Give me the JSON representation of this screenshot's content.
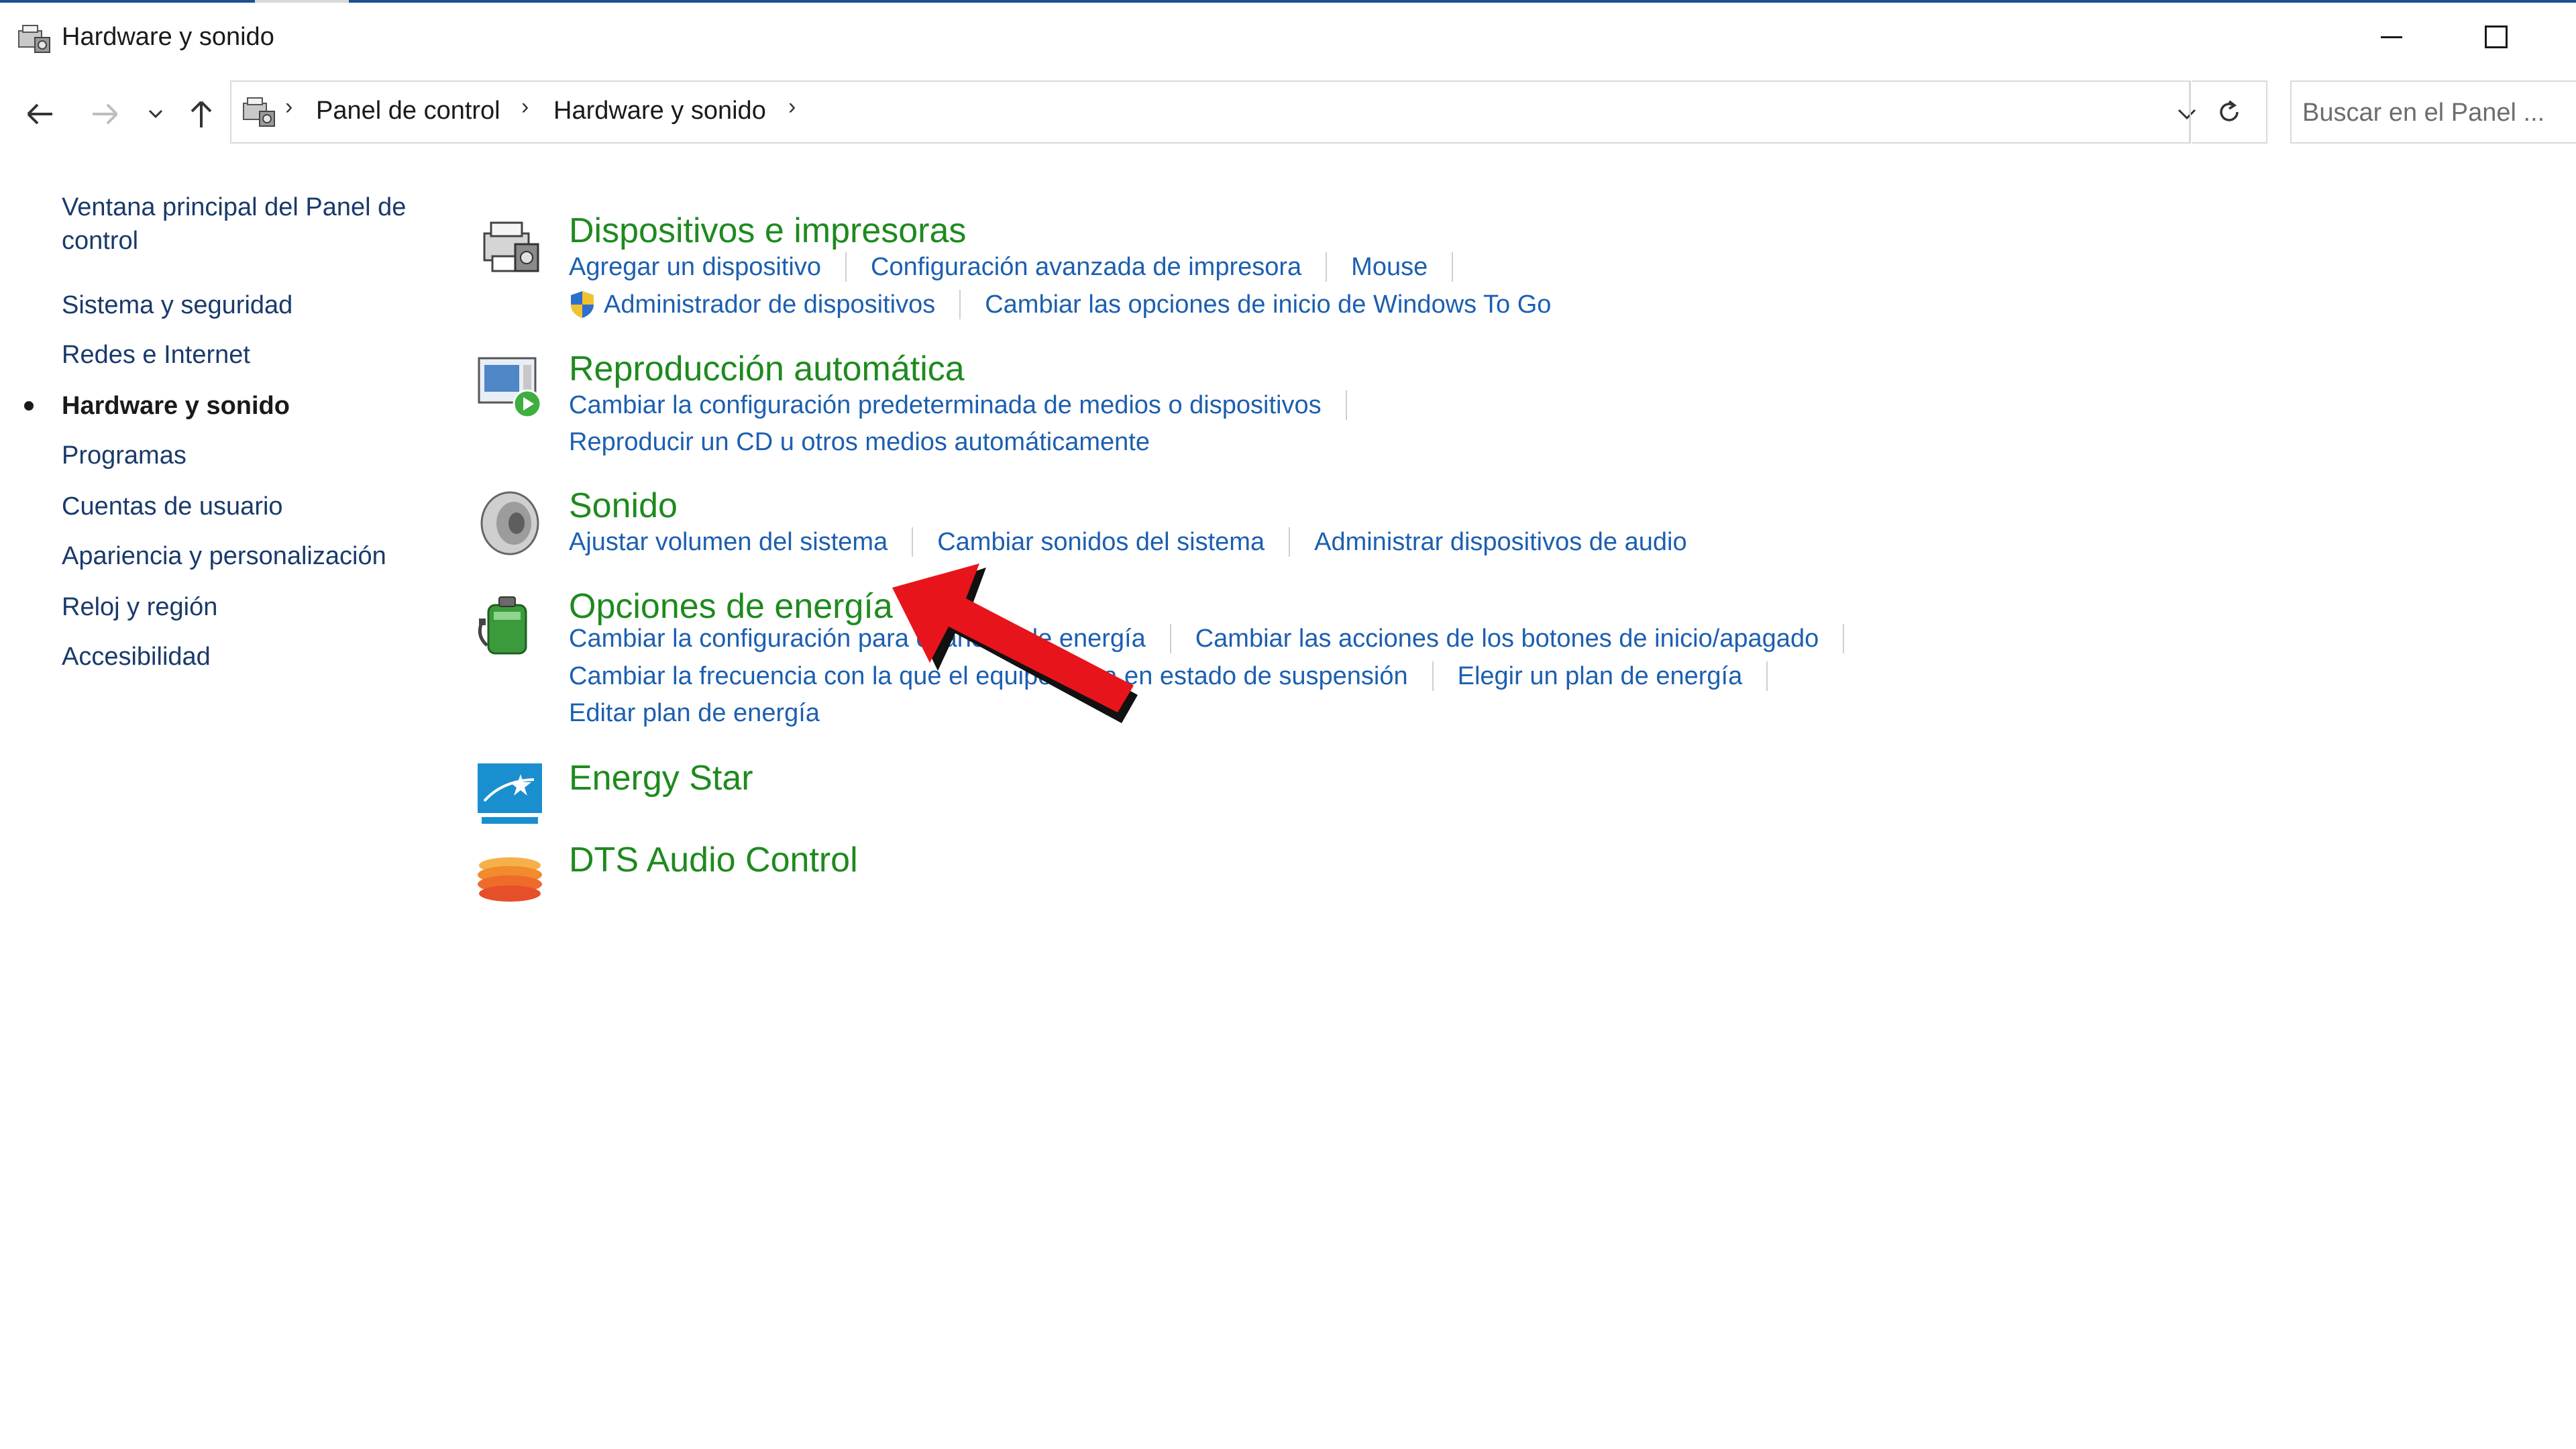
{
  "window": {
    "title": "Hardware y sonido"
  },
  "address_bar": {
    "crumbs": [
      "Panel de control",
      "Hardware y sonido"
    ]
  },
  "search": {
    "placeholder": "Buscar en el Panel ..."
  },
  "sidebar": {
    "items": [
      {
        "label": "Ventana principal del Panel de control",
        "active": false
      },
      {
        "label": "Sistema y seguridad",
        "active": false
      },
      {
        "label": "Redes e Internet",
        "active": false
      },
      {
        "label": "Hardware y sonido",
        "active": true
      },
      {
        "label": "Programas",
        "active": false
      },
      {
        "label": "Cuentas de usuario",
        "active": false
      },
      {
        "label": "Apariencia y personalización",
        "active": false
      },
      {
        "label": "Reloj y región",
        "active": false
      },
      {
        "label": "Accesibilidad",
        "active": false
      }
    ]
  },
  "categories": [
    {
      "title": "Dispositivos e impresoras",
      "icon": "printer-icon",
      "rows": [
        [
          "Agregar un dispositivo",
          "Configuración avanzada de impresora",
          "Mouse"
        ],
        [
          "Administrador de dispositivos",
          "Cambiar las opciones de inicio de Windows To Go"
        ]
      ]
    },
    {
      "title": "Reproducción automática",
      "icon": "autoplay-icon",
      "rows": [
        [
          "Cambiar la configuración predeterminada de medios o dispositivos"
        ],
        [
          "Reproducir un CD u otros medios automáticamente"
        ]
      ]
    },
    {
      "title": "Sonido",
      "icon": "speaker-icon",
      "rows": [
        [
          "Ajustar volumen del sistema",
          "Cambiar sonidos del sistema",
          "Administrar dispositivos de audio"
        ]
      ]
    },
    {
      "title": "Opciones de energía",
      "icon": "battery-icon",
      "rows": [
        [
          "Cambiar la configuración para el ahorro de energía",
          "Cambiar las acciones de los botones de inicio/apagado"
        ],
        [
          "Cambiar la frecuencia con la que el equipo entra en estado de suspensión",
          "Elegir un plan de energía"
        ],
        [
          "Editar plan de energía"
        ]
      ]
    },
    {
      "title": "Energy Star",
      "icon": "energy-star-icon",
      "rows": []
    },
    {
      "title": "DTS Audio Control",
      "icon": "dts-audio-icon",
      "rows": []
    }
  ],
  "colors": {
    "category_title": "#1e8a1e",
    "link": "#1c5fb0",
    "annotation_arrow": "#e8141b"
  }
}
